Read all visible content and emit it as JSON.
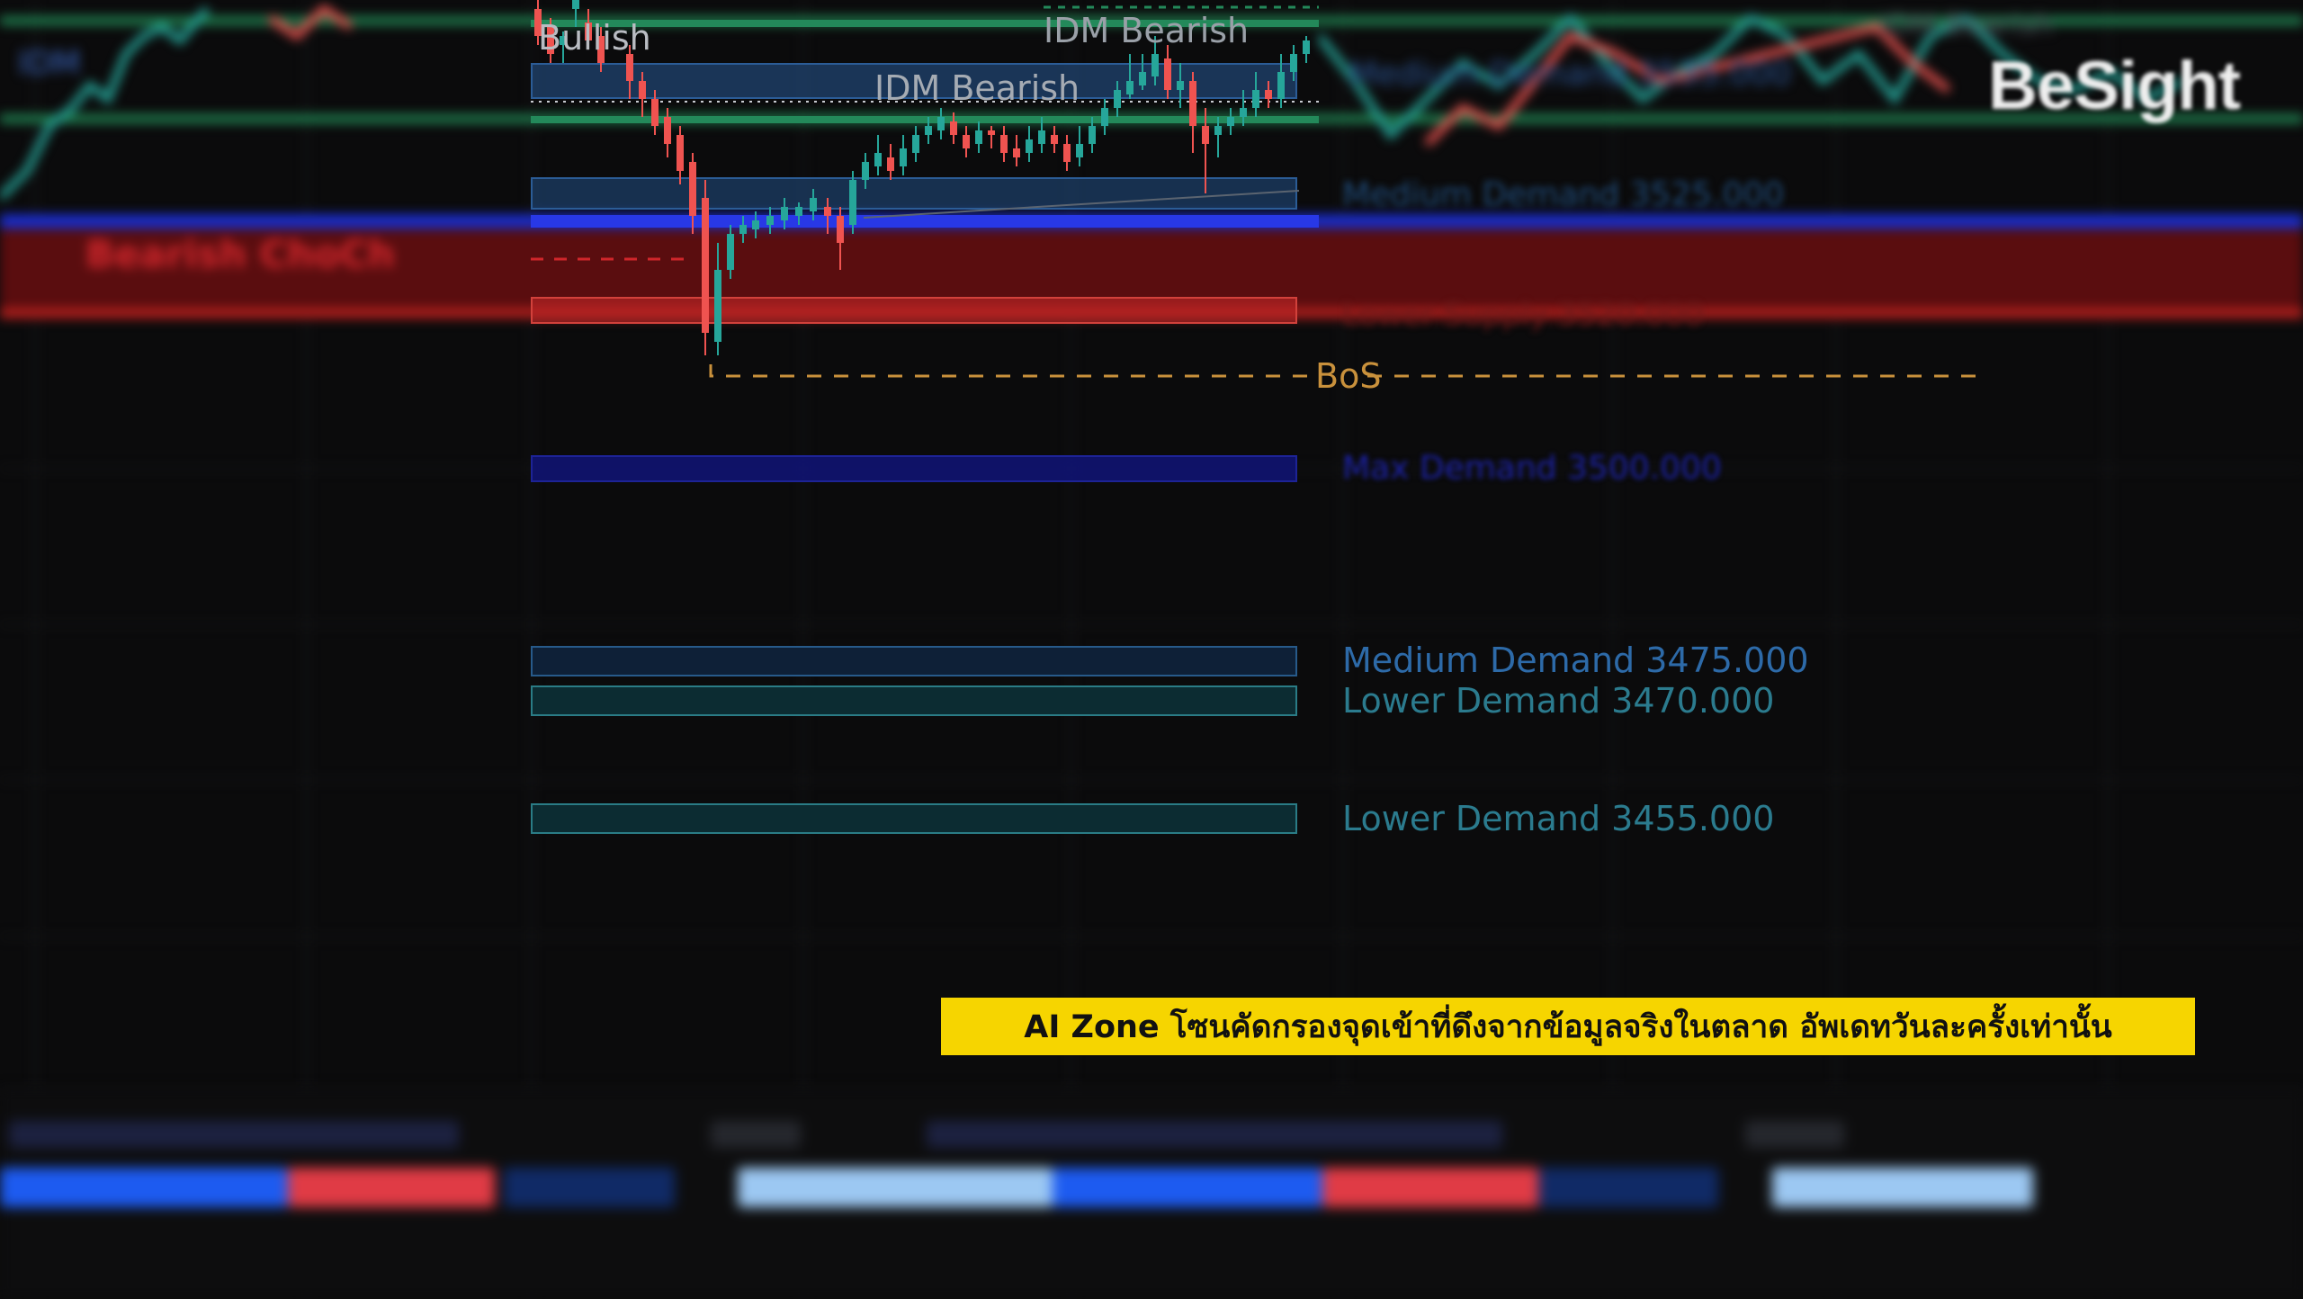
{
  "chart": {
    "labels": {
      "bullish": "Bullish",
      "idm_bearish_top": "IDM Bearish",
      "idm_bearish_mid": "IDM Bearish",
      "bearish_choch": "Bearish ChoCh",
      "bos": "BoS"
    },
    "zones": [
      {
        "name": "Max Demand",
        "price": "3500.000",
        "label": "Max Demand 3500.000",
        "color": "#1d2396"
      },
      {
        "name": "Medium Demand",
        "price": "3475.000",
        "label": "Medium Demand 3475.000",
        "color": "#2d6aa8"
      },
      {
        "name": "Lower Demand",
        "price": "3470.000",
        "label": "Lower Demand 3470.000",
        "color": "#2b7b8e"
      },
      {
        "name": "Lower Demand",
        "price": "3455.000",
        "label": "Lower Demand 3455.000",
        "color": "#2b7b8e"
      }
    ],
    "right_blurred": {
      "medium_demand_top": "Medium Demand 3535.000",
      "medium_demand_2": "Medium Demand 3525.000",
      "lower_supply": "Lower Supply 3520.000",
      "idm_bearish": "IDM Bearish"
    },
    "colors": {
      "bullish_candle": "#26a69a",
      "bearish_candle": "#ef5350",
      "bos_line": "#c9913c",
      "green_line": "#1f7d4e",
      "blue_line": "#1b2dc9",
      "supply_red": "#b8211e"
    }
  },
  "subtitle": {
    "text": "AI Zone โซนคัดกรองจุดเข้าที่ดึงจากข้อมูลจริงในตลาด อัพเดทวันละครั้งเท่านั้น",
    "background": "#f6d500"
  },
  "watermark": {
    "text": "BeSight"
  }
}
